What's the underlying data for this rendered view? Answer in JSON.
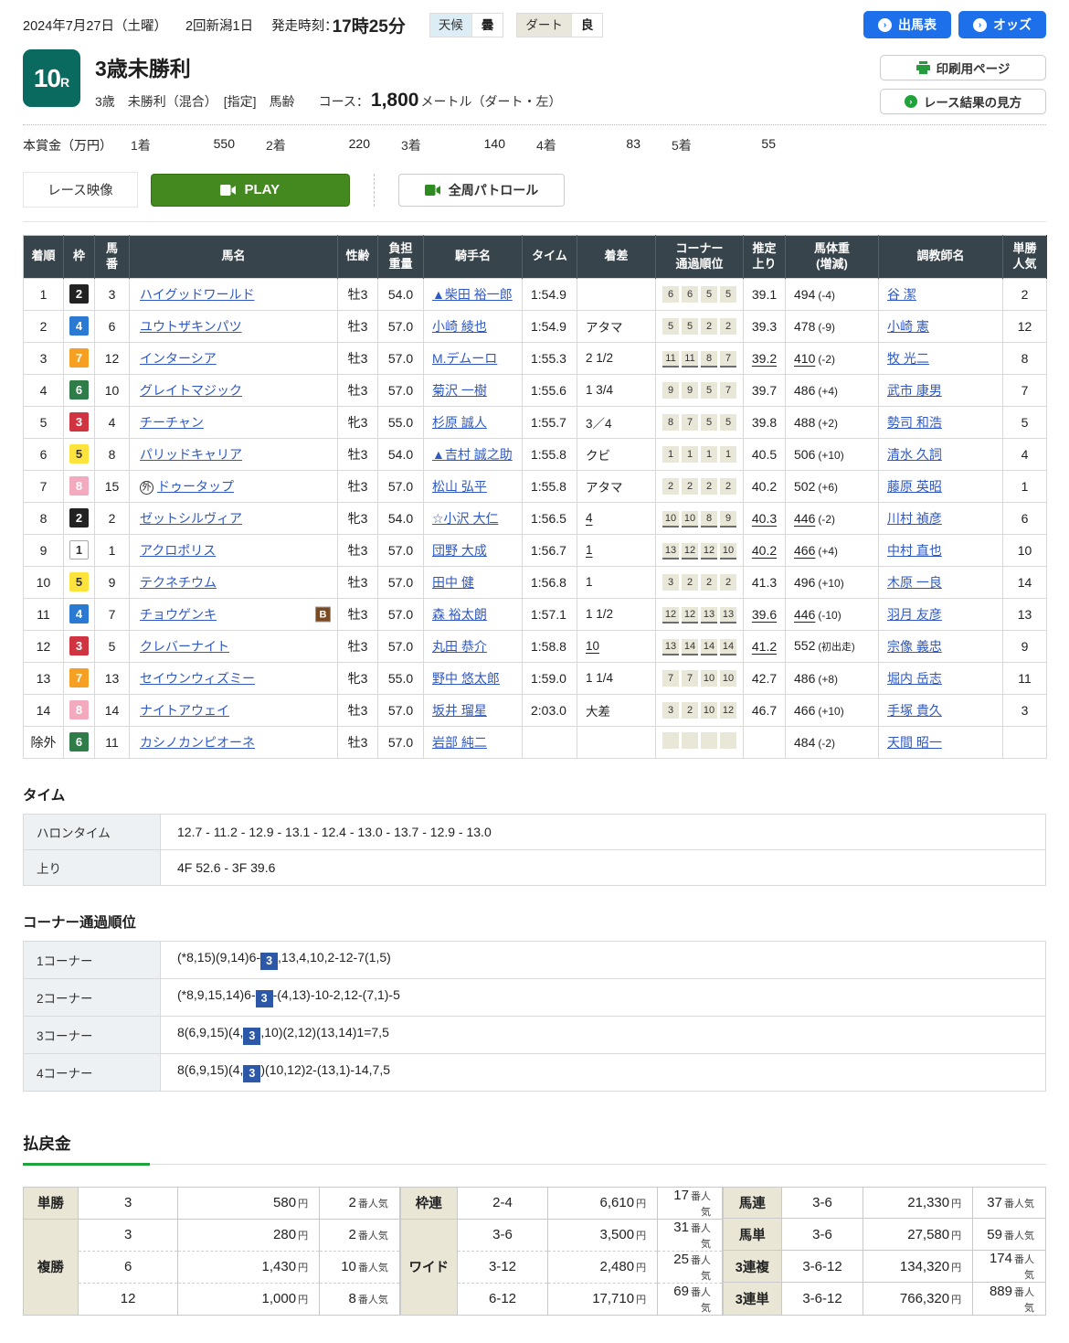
{
  "colors": {
    "accent_blue": "#1d6fea",
    "race_badge_green": "#0b6a5f",
    "play_green": "#44891f",
    "payout_underline_green": "#1fa43c",
    "link_blue": "#2f58c3",
    "corner_badge_blue": "#2d57a7",
    "table_header_bg": "#38444c"
  },
  "header": {
    "date": "2024年7月27日（土曜）",
    "meeting": "2回新潟1日",
    "start_label": "発走時刻：",
    "start_time": "17時25分",
    "weather_label": "天候",
    "weather_value": "曇",
    "track_label": "ダート",
    "track_value": "良",
    "btn_entries": "出馬表",
    "btn_odds": "オッズ",
    "btn_print": "印刷用ページ",
    "btn_guide": "レース結果の見方"
  },
  "race": {
    "number": "10",
    "number_suffix": "R",
    "title": "3歳未勝利",
    "conditions": "3歳　未勝利（混合）　[指定]　馬齢",
    "course_label": "コース：",
    "course_value": "1,800",
    "course_unit": "メートル（ダート・左）",
    "prize_label": "本賞金（万円）",
    "prizes": [
      {
        "place": "1着",
        "amount": "550"
      },
      {
        "place": "2着",
        "amount": "220"
      },
      {
        "place": "3着",
        "amount": "140"
      },
      {
        "place": "4着",
        "amount": "83"
      },
      {
        "place": "5着",
        "amount": "55"
      }
    ]
  },
  "video": {
    "label": "レース映像",
    "play": "PLAY",
    "patrol": "全周パトロール"
  },
  "results": {
    "b_label": "B",
    "headers": [
      "着順",
      "枠",
      "馬\n番",
      "馬名",
      "性齢",
      "負担\n重量",
      "騎手名",
      "タイム",
      "着差",
      "コーナー\n通過順位",
      "推定\n上り",
      "馬体重\n(増減)",
      "調教師名",
      "単勝\n人気"
    ],
    "rows": [
      {
        "pos": "1",
        "waku": "2",
        "wc": "w2",
        "num": "3",
        "horse": "ハイグッドワールド",
        "sexage": "牡3",
        "load": "54.0",
        "jockey": "▲柴田 裕一郎",
        "time": "1:54.9",
        "margin": "",
        "corners": [
          "6",
          "6",
          "5",
          "5"
        ],
        "agari": "39.1",
        "hw": "494",
        "hwd": "(-4)",
        "trainer": "谷 潔",
        "pop": "2"
      },
      {
        "pos": "2",
        "waku": "4",
        "wc": "w4",
        "num": "6",
        "horse": "ユウトザキンパツ",
        "sexage": "牡3",
        "load": "57.0",
        "jockey": "小崎 綾也",
        "time": "1:54.9",
        "margin": "アタマ",
        "corners": [
          "5",
          "5",
          "2",
          "2"
        ],
        "agari": "39.3",
        "hw": "478",
        "hwd": "(-9)",
        "trainer": "小崎 憲",
        "pop": "12"
      },
      {
        "pos": "3",
        "waku": "7",
        "wc": "w7",
        "num": "12",
        "horse": "インターシア",
        "sexage": "牡3",
        "load": "57.0",
        "jockey": "M.デムーロ",
        "time": "1:55.3",
        "margin": "2 1/2",
        "corners": [
          "11",
          "11",
          "8",
          "7"
        ],
        "cu": true,
        "agari": "39.2",
        "au": true,
        "hw": "410",
        "hwu": true,
        "hwd": "(-2)",
        "trainer": "牧 光二",
        "pop": "8"
      },
      {
        "pos": "4",
        "waku": "6",
        "wc": "w6",
        "num": "10",
        "horse": "グレイトマジック",
        "sexage": "牡3",
        "load": "57.0",
        "jockey": "菊沢 一樹",
        "time": "1:55.6",
        "margin": "1 3/4",
        "corners": [
          "9",
          "9",
          "5",
          "7"
        ],
        "agari": "39.7",
        "hw": "486",
        "hwd": "(+4)",
        "trainer": "武市 康男",
        "pop": "7"
      },
      {
        "pos": "5",
        "waku": "3",
        "wc": "w3",
        "num": "4",
        "horse": "チーチャン",
        "sexage": "牝3",
        "load": "55.0",
        "jockey": "杉原 誠人",
        "time": "1:55.7",
        "margin": "3／4",
        "corners": [
          "8",
          "7",
          "5",
          "5"
        ],
        "agari": "39.8",
        "hw": "488",
        "hwd": "(+2)",
        "trainer": "勢司 和浩",
        "pop": "5"
      },
      {
        "pos": "6",
        "waku": "5",
        "wc": "w5",
        "num": "8",
        "horse": "パリッドキャリア",
        "sexage": "牡3",
        "load": "54.0",
        "jockey": "▲吉村 誠之助",
        "time": "1:55.8",
        "margin": "クビ",
        "corners": [
          "1",
          "1",
          "1",
          "1"
        ],
        "agari": "40.5",
        "hw": "506",
        "hwd": "(+10)",
        "trainer": "清水 久詞",
        "pop": "4"
      },
      {
        "pos": "7",
        "waku": "8",
        "wc": "w8",
        "num": "15",
        "horse": "ドゥータップ",
        "mark": "外",
        "sexage": "牡3",
        "load": "57.0",
        "jockey": "松山 弘平",
        "time": "1:55.8",
        "margin": "アタマ",
        "corners": [
          "2",
          "2",
          "2",
          "2"
        ],
        "agari": "40.2",
        "hw": "502",
        "hwd": "(+6)",
        "trainer": "藤原 英昭",
        "pop": "1"
      },
      {
        "pos": "8",
        "waku": "2",
        "wc": "w2",
        "num": "2",
        "horse": "ゼットシルヴィア",
        "sexage": "牝3",
        "load": "54.0",
        "jockey": "☆小沢 大仁",
        "time": "1:56.5",
        "margin": "4",
        "mu": true,
        "corners": [
          "10",
          "10",
          "8",
          "9"
        ],
        "cu": true,
        "agari": "40.3",
        "au": true,
        "hw": "446",
        "hwu": true,
        "hwd": "(-2)",
        "trainer": "川村 禎彦",
        "pop": "6"
      },
      {
        "pos": "9",
        "waku": "1",
        "wc": "w1",
        "num": "1",
        "horse": "アクロポリス",
        "sexage": "牡3",
        "load": "57.0",
        "jockey": "団野 大成",
        "time": "1:56.7",
        "margin": "1",
        "mu": true,
        "corners": [
          "13",
          "12",
          "12",
          "10"
        ],
        "cu": true,
        "agari": "40.2",
        "au": true,
        "hw": "466",
        "hwu": true,
        "hwd": "(+4)",
        "trainer": "中村 直也",
        "pop": "10"
      },
      {
        "pos": "10",
        "waku": "5",
        "wc": "w5",
        "num": "9",
        "horse": "テクネチウム",
        "sexage": "牡3",
        "load": "57.0",
        "jockey": "田中 健",
        "time": "1:56.8",
        "margin": "1",
        "corners": [
          "3",
          "2",
          "2",
          "2"
        ],
        "agari": "41.3",
        "hw": "496",
        "hwd": "(+10)",
        "trainer": "木原 一良",
        "pop": "14"
      },
      {
        "pos": "11",
        "waku": "4",
        "wc": "w4",
        "num": "7",
        "horse": "チョウゲンキ",
        "b": true,
        "sexage": "牡3",
        "load": "57.0",
        "jockey": "森 裕太朗",
        "time": "1:57.1",
        "margin": "1 1/2",
        "corners": [
          "12",
          "12",
          "13",
          "13"
        ],
        "cu": true,
        "agari": "39.6",
        "au": true,
        "hw": "446",
        "hwu": true,
        "hwd": "(-10)",
        "trainer": "羽月 友彦",
        "pop": "13"
      },
      {
        "pos": "12",
        "waku": "3",
        "wc": "w3",
        "num": "5",
        "horse": "クレバーナイト",
        "sexage": "牡3",
        "load": "57.0",
        "jockey": "丸田 恭介",
        "time": "1:58.8",
        "margin": "10",
        "mu": true,
        "corners": [
          "13",
          "14",
          "14",
          "14"
        ],
        "cu": true,
        "agari": "41.2",
        "au": true,
        "hw": "552",
        "hwd": "(初出走)",
        "hwd_small": true,
        "trainer": "宗像 義忠",
        "pop": "9"
      },
      {
        "pos": "13",
        "waku": "7",
        "wc": "w7",
        "num": "13",
        "horse": "セイウンウィズミー",
        "sexage": "牝3",
        "load": "55.0",
        "jockey": "野中 悠太郎",
        "time": "1:59.0",
        "margin": "1 1/4",
        "corners": [
          "7",
          "7",
          "10",
          "10"
        ],
        "agari": "42.7",
        "hw": "486",
        "hwd": "(+8)",
        "trainer": "堀内 岳志",
        "pop": "11"
      },
      {
        "pos": "14",
        "waku": "8",
        "wc": "w8",
        "num": "14",
        "horse": "ナイトアウェイ",
        "sexage": "牡3",
        "load": "57.0",
        "jockey": "坂井 瑠星",
        "time": "2:03.0",
        "margin": "大差",
        "corners": [
          "3",
          "2",
          "10",
          "12"
        ],
        "agari": "46.7",
        "hw": "466",
        "hwd": "(+10)",
        "trainer": "手塚 貴久",
        "pop": "3"
      },
      {
        "pos": "除外",
        "waku": "6",
        "wc": "w6",
        "num": "11",
        "horse": "カシノカンピオーネ",
        "sexage": "牡3",
        "load": "57.0",
        "jockey": "岩部 純二",
        "time": "",
        "margin": "",
        "corners": [
          "",
          "",
          "",
          ""
        ],
        "agari": "",
        "hw": "484",
        "hwd": "(-2)",
        "trainer": "天間 昭一",
        "pop": ""
      }
    ]
  },
  "time_section": {
    "title": "タイム",
    "rows": [
      {
        "label": "ハロンタイム",
        "value": "12.7 - 11.2 - 12.9 - 13.1 - 12.4 - 13.0 - 13.7 - 12.9 - 13.0"
      },
      {
        "label": "上り",
        "value": "4F 52.6 - 3F 39.6"
      }
    ]
  },
  "corner_section": {
    "title": "コーナー通過順位",
    "rows": [
      {
        "label": "1コーナー",
        "pre": "(*8,15)(9,14)6-",
        "badge": "3",
        "post": ",13,4,10,2-12-7(1,5)"
      },
      {
        "label": "2コーナー",
        "pre": "(*8,9,15,14)6-",
        "badge": "3",
        "post": "-(4,13)-10-2,12-(7,1)-5"
      },
      {
        "label": "3コーナー",
        "pre": "8(6,9,15)(4,",
        "badge": "3",
        "post": ",10)(2,12)(13,14)1=7,5"
      },
      {
        "label": "4コーナー",
        "pre": "8(6,9,15)(4,",
        "badge": "3",
        "post": ")(10,12)2-(13,1)-14,7,5"
      }
    ]
  },
  "payout": {
    "title": "払戻金",
    "unit_amount": "円",
    "unit_pop": "番人気",
    "groups": [
      {
        "blocks": [
          {
            "label": "単勝",
            "rows": [
              {
                "combo": "3",
                "amount": "580",
                "pop": "2"
              }
            ]
          },
          {
            "label": "複勝",
            "rows": [
              {
                "combo": "3",
                "amount": "280",
                "pop": "2"
              },
              {
                "combo": "6",
                "amount": "1,430",
                "pop": "10"
              },
              {
                "combo": "12",
                "amount": "1,000",
                "pop": "8"
              }
            ]
          }
        ]
      },
      {
        "blocks": [
          {
            "label": "枠連",
            "rows": [
              {
                "combo": "2-4",
                "amount": "6,610",
                "pop": "17"
              }
            ]
          },
          {
            "label": "ワイド",
            "rows": [
              {
                "combo": "3-6",
                "amount": "3,500",
                "pop": "31"
              },
              {
                "combo": "3-12",
                "amount": "2,480",
                "pop": "25"
              },
              {
                "combo": "6-12",
                "amount": "17,710",
                "pop": "69"
              }
            ]
          }
        ]
      },
      {
        "blocks": [
          {
            "label": "馬連",
            "rows": [
              {
                "combo": "3-6",
                "amount": "21,330",
                "pop": "37"
              }
            ]
          },
          {
            "label": "馬単",
            "rows": [
              {
                "combo": "3-6",
                "amount": "27,580",
                "pop": "59"
              }
            ]
          },
          {
            "label": "3連複",
            "rows": [
              {
                "combo": "3-6-12",
                "amount": "134,320",
                "pop": "174"
              }
            ]
          },
          {
            "label": "3連単",
            "rows": [
              {
                "combo": "3-6-12",
                "amount": "766,320",
                "pop": "889"
              }
            ]
          }
        ]
      }
    ]
  }
}
